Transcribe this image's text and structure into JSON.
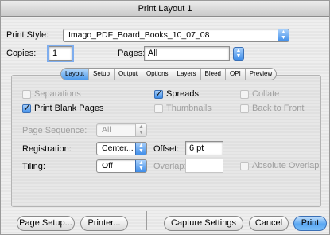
{
  "window": {
    "title": "Print Layout 1"
  },
  "print_style": {
    "label": "Print Style:",
    "value": "Imago_PDF_Board_Books_10_07_08"
  },
  "copies": {
    "label": "Copies:",
    "value": "1"
  },
  "pages": {
    "label": "Pages:",
    "value": "All"
  },
  "tabs": [
    "Layout",
    "Setup",
    "Output",
    "Options",
    "Layers",
    "Bleed",
    "OPI",
    "Preview"
  ],
  "active_tab": "Layout",
  "checkboxes": {
    "separations": {
      "label": "Separations",
      "checked": false,
      "enabled": false
    },
    "spreads": {
      "label": "Spreads",
      "checked": true,
      "enabled": true
    },
    "collate": {
      "label": "Collate",
      "checked": false,
      "enabled": false
    },
    "print_blank_pages": {
      "label": "Print Blank Pages",
      "checked": true,
      "enabled": true
    },
    "thumbnails": {
      "label": "Thumbnails",
      "checked": false,
      "enabled": false
    },
    "back_to_front": {
      "label": "Back to Front",
      "checked": false,
      "enabled": false
    },
    "absolute_overlap": {
      "label": "Absolute Overlap",
      "checked": false,
      "enabled": false
    }
  },
  "page_sequence": {
    "label": "Page Sequence:",
    "value": "All"
  },
  "registration": {
    "label": "Registration:",
    "value": "Center..."
  },
  "offset": {
    "label": "Offset:",
    "value": "6 pt"
  },
  "tiling": {
    "label": "Tiling:",
    "value": "Off"
  },
  "overlap": {
    "label": "Overlap:",
    "value": ""
  },
  "buttons": {
    "page_setup": "Page Setup...",
    "printer": "Printer...",
    "capture_settings": "Capture Settings",
    "cancel": "Cancel",
    "print": "Print"
  },
  "colors": {
    "accent": "#3f8ee9",
    "disabled_text": "#9f9f9f"
  }
}
